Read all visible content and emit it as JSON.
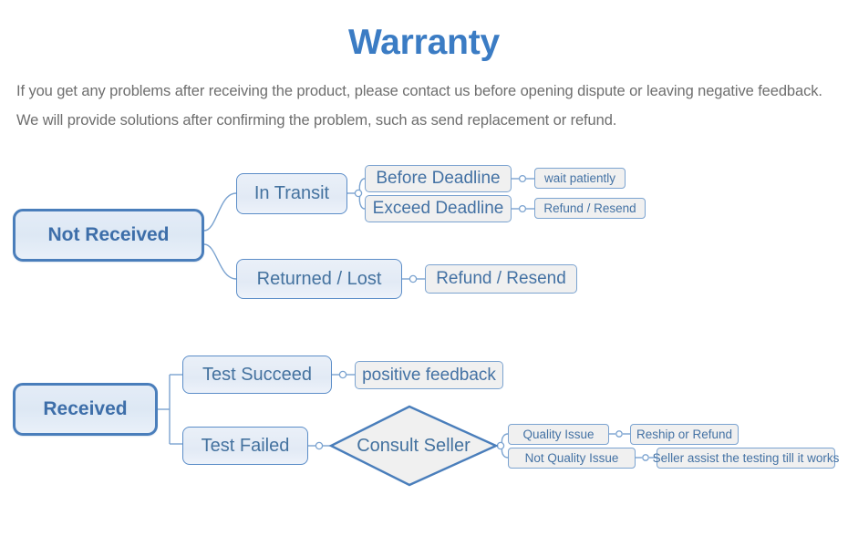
{
  "header": {
    "title": "Warranty",
    "intro": "If you get any problems after receiving the product, please contact us before opening dispute or leaving negative feedback. We will provide solutions after confirming the problem, such as send replacement or refund."
  },
  "colors": {
    "title_blue": "#3b7cc4",
    "node_border": "#4a7ebb",
    "node_text": "#44729f",
    "node_fill_light": "#e4ecf7",
    "leaf_fill": "#f0f0f0",
    "connector": "#7ba3d0",
    "intro_text": "#6e6e6e",
    "background": "#ffffff"
  },
  "diagram": {
    "branches": [
      {
        "id": "not-received",
        "root": "Not Received",
        "children": [
          {
            "id": "in-transit",
            "label": "In Transit",
            "children": [
              {
                "id": "before-deadline",
                "label": "Before Deadline",
                "leaf": "wait patiently"
              },
              {
                "id": "exceed-deadline",
                "label": "Exceed Deadline",
                "leaf": "Refund / Resend"
              }
            ]
          },
          {
            "id": "returned-lost",
            "label": "Returned / Lost",
            "children": [
              {
                "id": "returned-lost-action",
                "label": "Refund / Resend",
                "leaf": null
              }
            ]
          }
        ]
      },
      {
        "id": "received",
        "root": "Received",
        "children": [
          {
            "id": "test-succeed",
            "label": "Test Succeed",
            "children": [
              {
                "id": "positive-feedback",
                "label": "positive feedback",
                "leaf": null
              }
            ]
          },
          {
            "id": "test-failed",
            "label": "Test Failed",
            "decision": "Consult Seller",
            "children": [
              {
                "id": "quality-issue",
                "label": "Quality Issue",
                "leaf": "Reship or Refund"
              },
              {
                "id": "not-quality-issue",
                "label": "Not Quality Issue",
                "leaf": "Seller assist the testing till it works"
              }
            ]
          }
        ]
      }
    ]
  }
}
